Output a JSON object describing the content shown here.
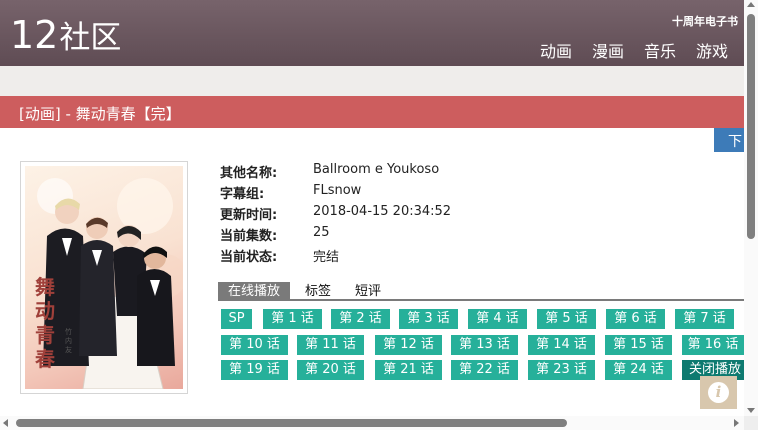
{
  "header": {
    "logo_number": "12",
    "logo_text": "社区",
    "anniversary": "十周年电子书",
    "nav": [
      {
        "label": "动画"
      },
      {
        "label": "漫画"
      },
      {
        "label": "音乐"
      },
      {
        "label": "游戏"
      }
    ]
  },
  "page": {
    "title": "[动画] - 舞动青春【完】",
    "download_tab": "下"
  },
  "cover": {
    "vertical_title": "舞动青春",
    "author": "竹内友"
  },
  "info": [
    {
      "key": "其他名称:",
      "value": "Ballroom e Youkoso"
    },
    {
      "key": "字幕组:",
      "value": "FLsnow"
    },
    {
      "key": "更新时间:",
      "value": "2018-04-15 20:34:52"
    },
    {
      "key": "当前集数:",
      "value": "25"
    },
    {
      "key": "当前状态:",
      "value": "完结"
    }
  ],
  "tabs": [
    {
      "label": "在线播放",
      "active": true
    },
    {
      "label": "标签",
      "active": false
    },
    {
      "label": "短评",
      "active": false
    }
  ],
  "episodes": [
    [
      "SP",
      "第 1 话",
      "第 2 话",
      "第 3 话",
      "第 4 话",
      "第 5 话",
      "第 6 话",
      "第 7 话"
    ],
    [
      "第 10 话",
      "第 11 话",
      "第 12 话",
      "第 13 话",
      "第 14 话",
      "第 15 话",
      "第 16 话"
    ],
    [
      "第 19 话",
      "第 20 话",
      "第 21 话",
      "第 22 话",
      "第 23 话",
      "第 24 话",
      "关闭播放"
    ]
  ],
  "info_button": "i",
  "colors": {
    "header": "#6b5760",
    "title_bar": "#cd5d5e",
    "episode_button": "#26b09a",
    "close_button": "#0e7a70",
    "download_tab": "#3d7bb8"
  }
}
